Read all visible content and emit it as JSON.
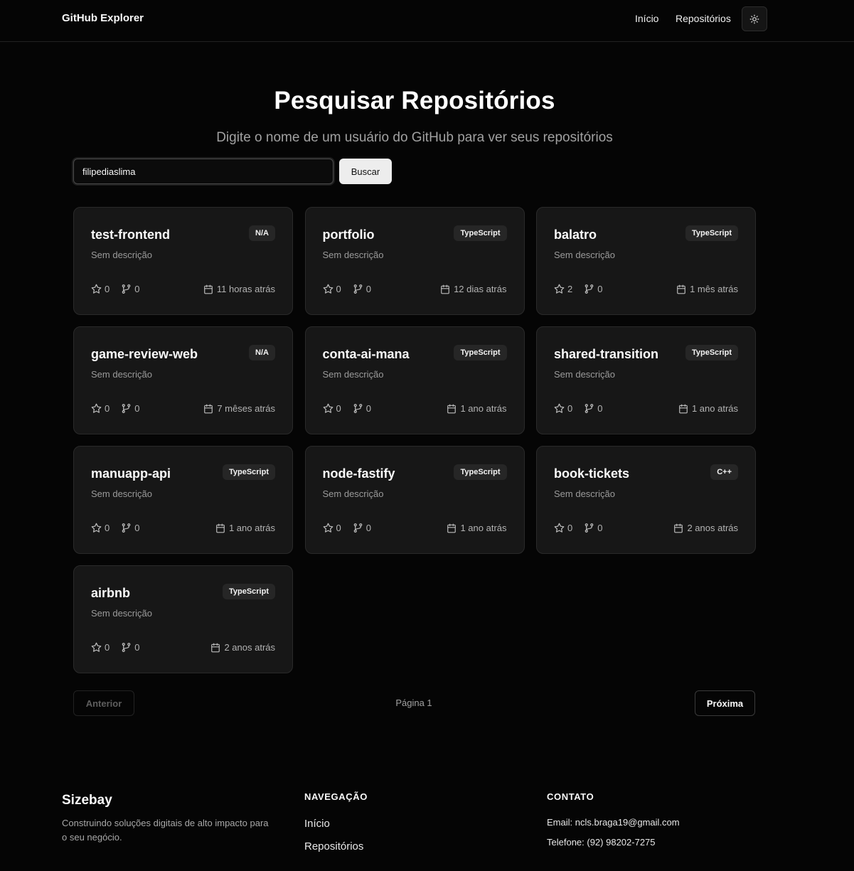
{
  "header": {
    "brand": "GitHub Explorer",
    "nav": [
      "Início",
      "Repositórios"
    ],
    "theme_icon": "sun-icon"
  },
  "hero": {
    "title": "Pesquisar Repositórios",
    "subtitle": "Digite o nome de um usuário do GitHub para ver seus repositórios"
  },
  "search": {
    "value": "filipediaslima",
    "button_label": "Buscar"
  },
  "repos": [
    {
      "name": "test-frontend",
      "description": "Sem descrição",
      "language": "N/A",
      "stars": "0",
      "forks": "0",
      "updated": "11 horas atrás"
    },
    {
      "name": "portfolio",
      "description": "Sem descrição",
      "language": "TypeScript",
      "stars": "0",
      "forks": "0",
      "updated": "12 dias atrás"
    },
    {
      "name": "balatro",
      "description": "Sem descrição",
      "language": "TypeScript",
      "stars": "2",
      "forks": "0",
      "updated": "1 mês atrás"
    },
    {
      "name": "game-review-web",
      "description": "Sem descrição",
      "language": "N/A",
      "stars": "0",
      "forks": "0",
      "updated": "7 mêses atrás"
    },
    {
      "name": "conta-ai-mana",
      "description": "Sem descrição",
      "language": "TypeScript",
      "stars": "0",
      "forks": "0",
      "updated": "1 ano atrás"
    },
    {
      "name": "shared-transition",
      "description": "Sem descrição",
      "language": "TypeScript",
      "stars": "0",
      "forks": "0",
      "updated": "1 ano atrás"
    },
    {
      "name": "manuapp-api",
      "description": "Sem descrição",
      "language": "TypeScript",
      "stars": "0",
      "forks": "0",
      "updated": "1 ano atrás"
    },
    {
      "name": "node-fastify",
      "description": "Sem descrição",
      "language": "TypeScript",
      "stars": "0",
      "forks": "0",
      "updated": "1 ano atrás"
    },
    {
      "name": "book-tickets",
      "description": "Sem descrição",
      "language": "C++",
      "stars": "0",
      "forks": "0",
      "updated": "2 anos atrás"
    },
    {
      "name": "airbnb",
      "description": "Sem descrição",
      "language": "TypeScript",
      "stars": "0",
      "forks": "0",
      "updated": "2 anos atrás"
    }
  ],
  "pagination": {
    "prev": "Anterior",
    "label": "Página 1",
    "next": "Próxima"
  },
  "footer": {
    "brand": "Sizebay",
    "tagline": "Construindo soluções digitais de alto impacto para o seu negócio.",
    "nav_heading": "NAVEGAÇÃO",
    "nav_links": [
      "Início",
      "Repositórios"
    ],
    "contact_heading": "CONTATO",
    "email": "Email: ncls.braga19@gmail.com",
    "phone": "Telefone: (92) 98202-7275"
  },
  "colors": {
    "background": "#050505",
    "card": "#171717",
    "card_border": "#2a2a2a",
    "muted_text": "#a1a1a1"
  }
}
